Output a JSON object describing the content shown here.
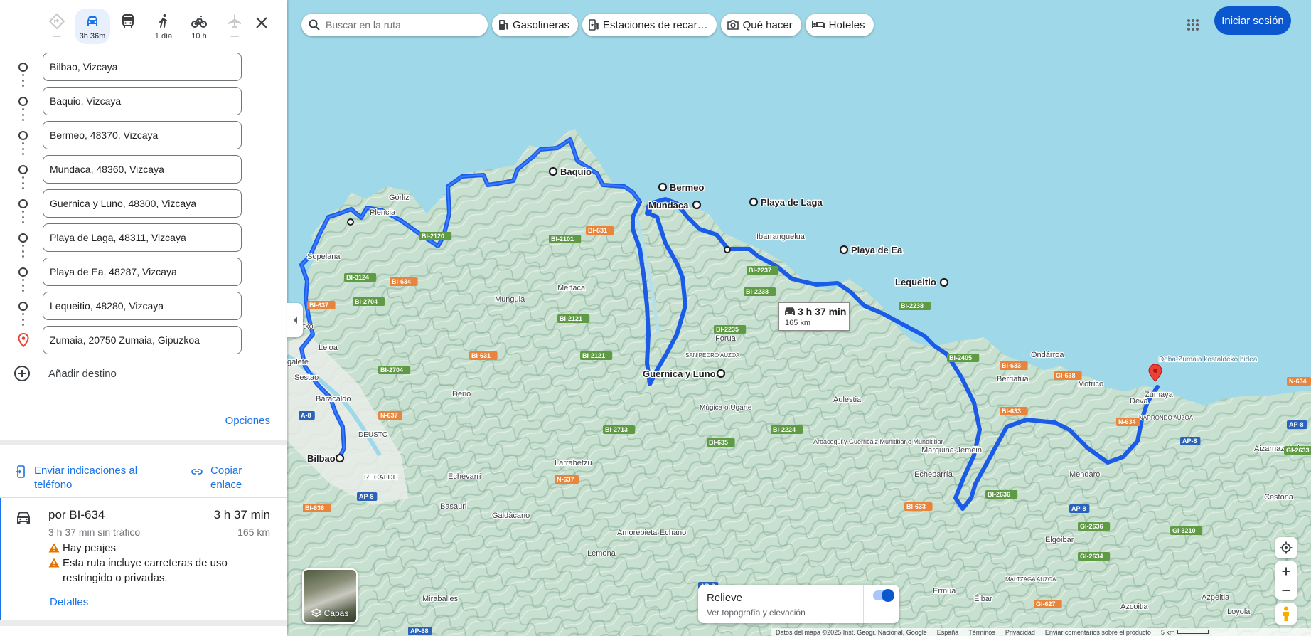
{
  "travel_modes": [
    {
      "name": "best",
      "label": "—"
    },
    {
      "name": "car",
      "label": "3h 36m"
    },
    {
      "name": "transit",
      "label": ""
    },
    {
      "name": "walk",
      "label": "1 día"
    },
    {
      "name": "bike",
      "label": "10 h"
    },
    {
      "name": "flight",
      "label": "—"
    }
  ],
  "stops": [
    "Bilbao, Vizcaya",
    "Baquio, Vizcaya",
    "Bermeo, 48370, Vizcaya",
    "Mundaca, 48360, Vizcaya",
    "Guernica y Luno, 48300, Vizcaya",
    "Playa de Laga, 48311, Vizcaya",
    "Playa de Ea, 48287, Vizcaya",
    "Lequeitio, 48280, Vizcaya",
    "Zumaia, 20750 Zumaia, Gipuzkoa"
  ],
  "add_destination": "Añadir destino",
  "options_label": "Opciones",
  "send_to_phone": "Enviar indicaciones al teléfono",
  "copy_link": "Copiar enlace",
  "route": {
    "via": "por BI-634",
    "duration": "3 h 37 min",
    "no_traffic": "3 h 37 min sin tráfico",
    "distance": "165 km",
    "warning_tolls": "Hay peajes",
    "warning_restricted": "Esta ruta incluye carreteras de uso restringido o privadas.",
    "details": "Detalles"
  },
  "map": {
    "search_placeholder": "Buscar en la ruta",
    "chips": [
      "Gasolineras",
      "Estaciones de recar…",
      "Qué hacer",
      "Hoteles"
    ],
    "sign_in": "Iniciar sesión",
    "route_tooltip": {
      "duration": "3 h 37 min",
      "distance": "165 km"
    },
    "layers_label": "Capas",
    "relief_title": "Relieve",
    "relief_subtitle": "Ver topografía y elevación",
    "footer": {
      "data": "Datos del mapa ©2025 Inst. Geogr. Nacional, Google",
      "country": "España",
      "terms": "Términos",
      "privacy": "Privacidad",
      "feedback": "Enviar comentarios sobre el producto",
      "scale": "5 km"
    },
    "place_labels": {
      "bilbao": "Bilbao",
      "baquio": "Baquio",
      "bermeo": "Bermeo",
      "mundaca": "Mundaca",
      "guernica": "Guernica y Luno",
      "laga": "Playa de Laga",
      "ea": "Playa de Ea",
      "lequeitio": "Lequeitio",
      "zumaya": "Zumaya",
      "gorliz": "Górliz",
      "plencia": "Plencia",
      "sopelana": "Sopelana",
      "munguia": "Munguia",
      "menaca": "Meñaca",
      "ibarranguelua": "Ibarranguelua",
      "forua": "Forua",
      "sanpedro": "SAN PEDRO AUZOA",
      "mugica": "Múgica o Ugarte",
      "aulestia": "Aulestia",
      "berriatua": "Berriatúa",
      "ondarroa": "Ondárroa",
      "motrico": "Motrico",
      "deva": "Deva",
      "deba": "Deba-Zumaia kostaldeko bidea",
      "mendaro": "Mendaro",
      "elgoibar": "Elgóibar",
      "eibar": "Éibar",
      "ermua": "Ermua",
      "markina": "Marquina-Jeméin",
      "echebarria": "Echebarría",
      "arbacegui": "Arbácegui y Guerricaiz Munitibar o Munditibar",
      "lemona": "Lemona",
      "amorebieta": "Amorebieta-Echano",
      "larrabetzu": "Larrabetzu",
      "derio": "Derio",
      "echevarri": "Echévarri",
      "basauri": "Basauri",
      "galdacano": "Galdácano",
      "baracaldo": "Baracaldo",
      "sestao": "Sestao",
      "galete": "galete",
      "leioa": "Leioa",
      "getxo": "etxo",
      "deusto": "DEUSTO",
      "recalde": "RECALDE",
      "miraballes": "Miraballes",
      "maltzaga": "MALTZAGA AUZOA",
      "narrondo": "NARRONDO AUZOA",
      "aizarnazabal": "Aizarnazabal",
      "cestona": "Cestona",
      "azcoitia": "Azcoitia",
      "azpeitia": "Azpeitia",
      "loyola": "Loyola"
    },
    "road_labels": {
      "r1": "BI-631",
      "r2": "BI-2120",
      "r3": "BI-2101",
      "r4": "BI-3124",
      "r5": "BI-634",
      "r6": "BI-637",
      "r7": "BI-2704",
      "r8": "BI-2121",
      "r9": "BI-631",
      "r10": "BI-2121",
      "r11": "BI-2237",
      "r12": "BI-2238",
      "r13": "BI-2238",
      "r14": "BI-2235",
      "r15": "BI-2405",
      "r16": "BI-633",
      "r17": "GI-638",
      "r18": "BI-2704",
      "r19": "N-637",
      "r20": "A-8",
      "r21": "BI-2713",
      "r22": "BI-2224",
      "r23": "BI-635",
      "r24": "BI-633",
      "r25": "N-637",
      "r26": "AP-8",
      "r27": "BI-636",
      "r28": "BI-2636",
      "r29": "BI-633",
      "r30": "N-634",
      "r31": "AP-8",
      "r32": "AP-8",
      "r33": "GI-2636",
      "r34": "GI-2634",
      "r35": "GI-3210",
      "r36": "GI-627",
      "r37": "AP-8",
      "r38": "AP-68",
      "r39": "N-634",
      "r40": "AP-8",
      "r41": "GI-2633"
    }
  }
}
